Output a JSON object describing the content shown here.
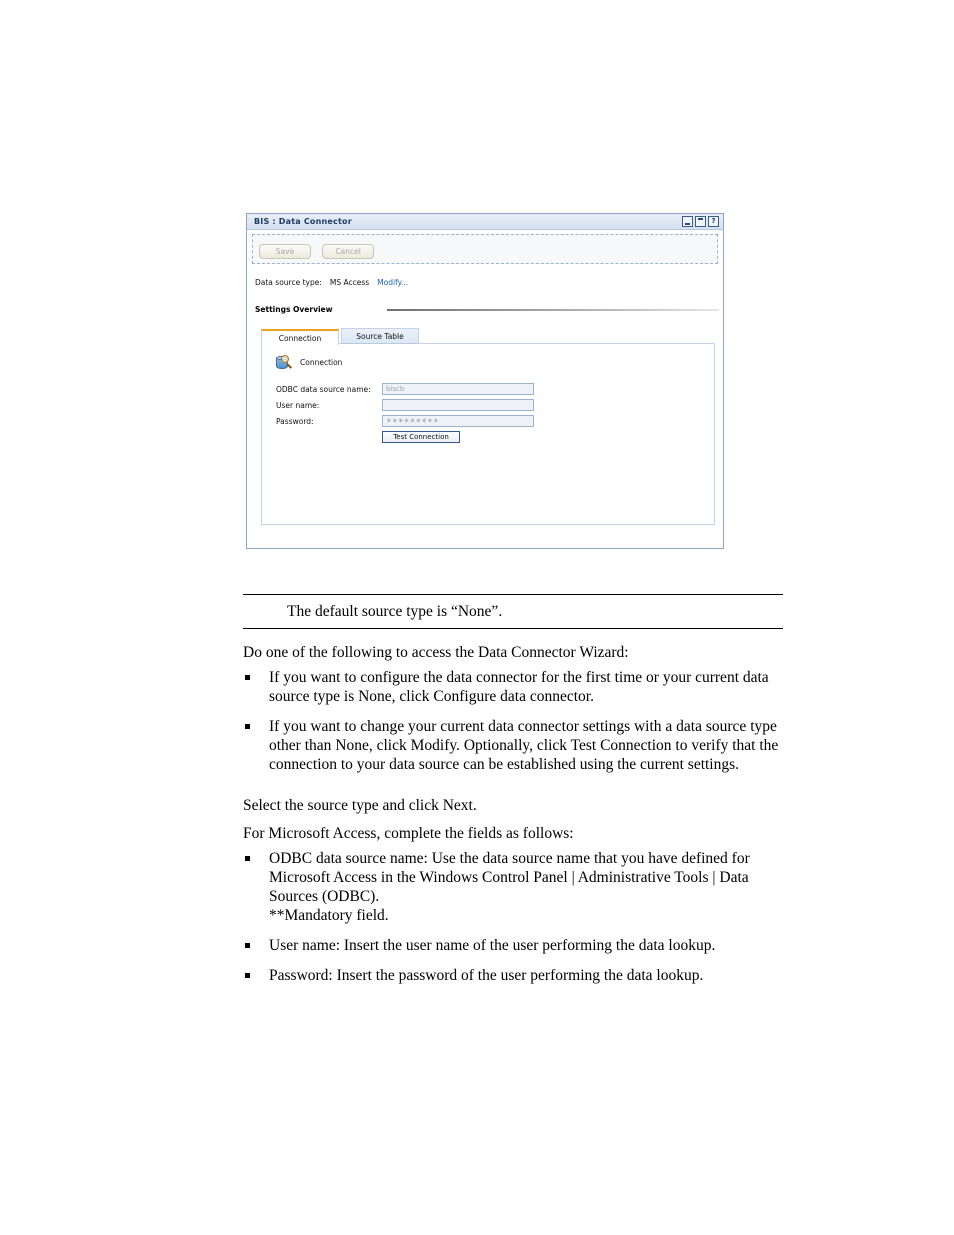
{
  "app_window": {
    "title": "BIS : Data Connector",
    "window_buttons": [
      {
        "name": "minimize",
        "glyph": ""
      },
      {
        "name": "maximize",
        "glyph": ""
      },
      {
        "name": "help",
        "glyph": "?"
      }
    ],
    "toolbar": {
      "save_label": "Save",
      "cancel_label": "Cancel"
    },
    "data_source": {
      "label": "Data source type:",
      "value": "MS Access",
      "modify_link": "Modify..."
    },
    "settings_overview_heading": "Settings Overview",
    "tabs": [
      {
        "label": "Connection",
        "active": true
      },
      {
        "label": "Source Table",
        "active": false
      }
    ],
    "connection_group": {
      "icon": "database-search-icon",
      "title": "Connection",
      "fields": [
        {
          "label": "ODBC data source name:",
          "value": "biscb",
          "type": "text"
        },
        {
          "label": "User name:",
          "value": "",
          "type": "text"
        },
        {
          "label": "Password:",
          "value": "✶✶✶✶✶✶✶✶✶",
          "type": "password"
        }
      ],
      "test_button": "Test Connection"
    }
  },
  "document": {
    "note": "The default source type is “None”.",
    "intro_paragraph": "Do one of the following to access the Data Connector Wizard:",
    "access_bullets": [
      "If you want to configure the data connector for the first time or your current data source type is None, click Configure data connector.",
      "If you want to change your current data connector settings with a data source type other than None, click Modify. Optionally, click Test Connection to verify that the connection to your data source can be established using the current settings."
    ],
    "select_paragraph": "Select the source type and click Next.",
    "fields_paragraph": "For Microsoft Access, complete the fields as follows:",
    "field_bullets": [
      "ODBC data source name: Use the data source name that you have defined for Microsoft Access in the Windows Control Panel | Administrative Tools | Data Sources (ODBC).\n**Mandatory field.",
      "User name: Insert the user name of the user performing the data lookup.",
      "Password: Insert the password of the user performing the data lookup."
    ]
  },
  "colors": {
    "titlebar": "#d6e0f0",
    "title_text": "#1d3c66",
    "link": "#1a63b8",
    "active_tab_accent": "#f0a21c",
    "panel_border": "#c6d3e6"
  }
}
